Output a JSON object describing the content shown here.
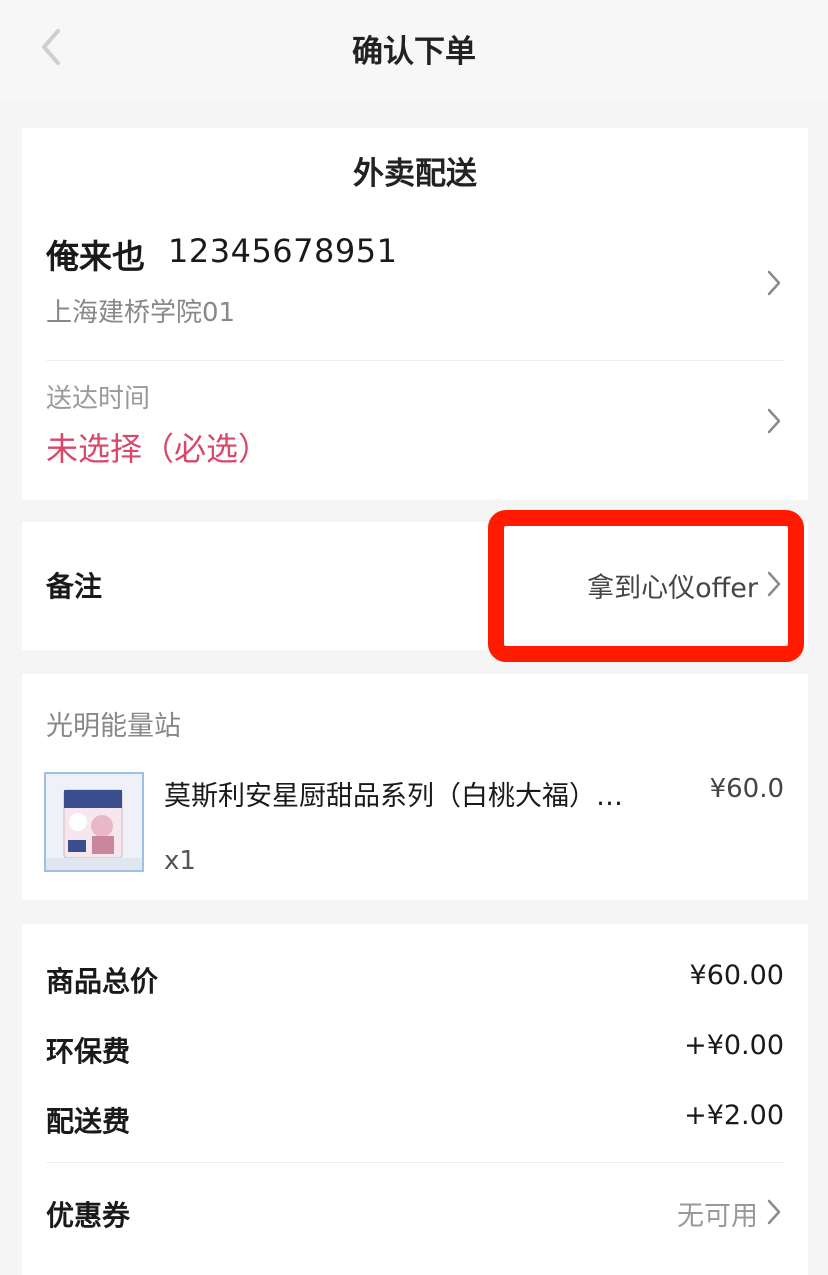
{
  "header": {
    "title": "确认下单"
  },
  "delivery": {
    "mode_title": "外卖配送",
    "contact_name": "俺来也",
    "contact_phone": "12345678951",
    "address": "上海建桥学院01",
    "time_label": "送达时间",
    "time_value": "未选择（必选）"
  },
  "remark": {
    "label": "备注",
    "value": "拿到心仪offer"
  },
  "shop": {
    "name": "光明能量站",
    "product_name": "莫斯利安星厨甜品系列（白桃大福）…",
    "product_price": "¥60.0",
    "product_qty": "x1"
  },
  "fees": [
    {
      "label": "商品总价",
      "value": "¥60.00"
    },
    {
      "label": "环保费",
      "value": "+¥0.00"
    },
    {
      "label": "配送费",
      "value": "+¥2.00"
    }
  ],
  "coupon": {
    "label": "优惠券",
    "value": "无可用"
  },
  "colors": {
    "accent_pink": "#d9486a",
    "highlight_red": "#ff1a00"
  },
  "icons": {
    "back": "chevron-left-icon",
    "arrow": "chevron-right-icon"
  }
}
